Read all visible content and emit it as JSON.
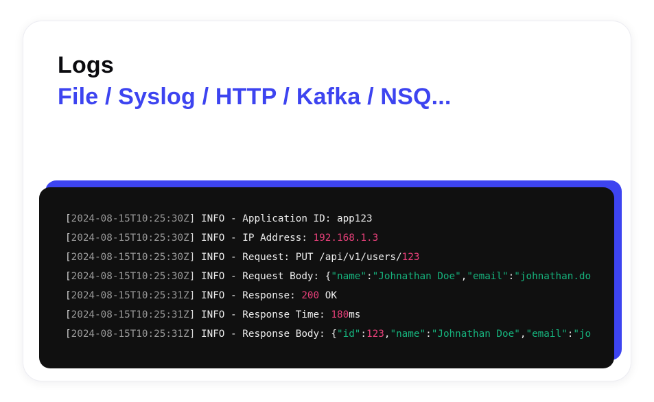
{
  "header": {
    "title": "Logs",
    "subtitle": "File / Syslog / HTTP / Kafka / NSQ..."
  },
  "colors": {
    "accent": "#3d44f0",
    "terminal_bg": "#101010",
    "timestamp": "#9a9a9a",
    "number": "#e8407a",
    "string": "#16b37d"
  },
  "log": {
    "lines": [
      {
        "timestamp": "2024-08-15T10:25:30Z",
        "level": "INFO",
        "message": "Application ID: app123"
      },
      {
        "timestamp": "2024-08-15T10:25:30Z",
        "level": "INFO",
        "label": "IP Address: ",
        "value": "192.168.1.3"
      },
      {
        "timestamp": "2024-08-15T10:25:30Z",
        "level": "INFO",
        "label": "Request: PUT /api/v1/users/",
        "value": "123"
      },
      {
        "timestamp": "2024-08-15T10:25:30Z",
        "level": "INFO",
        "label": "Request Body: ",
        "json": {
          "k1": "\"name\"",
          "v1": "\"Johnathan Doe\"",
          "k2": "\"email\"",
          "v2": "\"johnathan.do"
        }
      },
      {
        "timestamp": "2024-08-15T10:25:31Z",
        "level": "INFO",
        "label": "Response: ",
        "value": "200",
        "suffix": " OK"
      },
      {
        "timestamp": "2024-08-15T10:25:31Z",
        "level": "INFO",
        "label": "Response Time: ",
        "value": "180",
        "suffix": "ms"
      },
      {
        "timestamp": "2024-08-15T10:25:31Z",
        "level": "INFO",
        "label": "Response Body: ",
        "json": {
          "k1": "\"id\"",
          "v1": "123",
          "k2": "\"name\"",
          "v2": "\"Johnathan Doe\"",
          "k3": "\"email\"",
          "v3": "\"jo"
        }
      }
    ]
  }
}
